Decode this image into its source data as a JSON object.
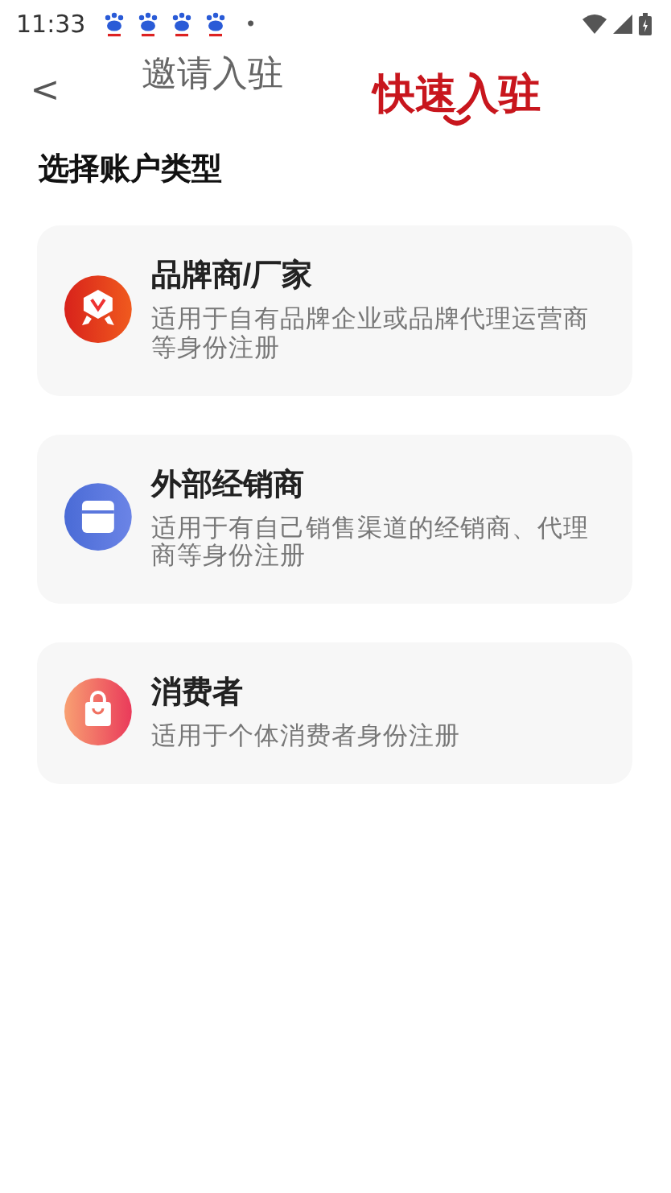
{
  "status_bar": {
    "time": "11:33",
    "notifications": [
      {
        "kind": "paw"
      },
      {
        "kind": "paw"
      },
      {
        "kind": "paw"
      },
      {
        "kind": "paw"
      }
    ],
    "dot": "•"
  },
  "nav": {
    "back": "<",
    "tabs": [
      {
        "label": "邀请入驻",
        "selected": false
      },
      {
        "label": "快速入驻",
        "selected": true
      }
    ]
  },
  "section_title": "选择账户类型",
  "account_types": [
    {
      "kind": "brand",
      "title": "品牌商/厂家",
      "description": "适用于自有品牌企业或品牌代理运营商等身份注册"
    },
    {
      "kind": "dealer",
      "title": "外部经销商",
      "description": "适用于有自己销售渠道的经销商、代理商等身份注册"
    },
    {
      "kind": "consumer",
      "title": "消费者",
      "description": "适用于个体消费者身份注册"
    }
  ]
}
